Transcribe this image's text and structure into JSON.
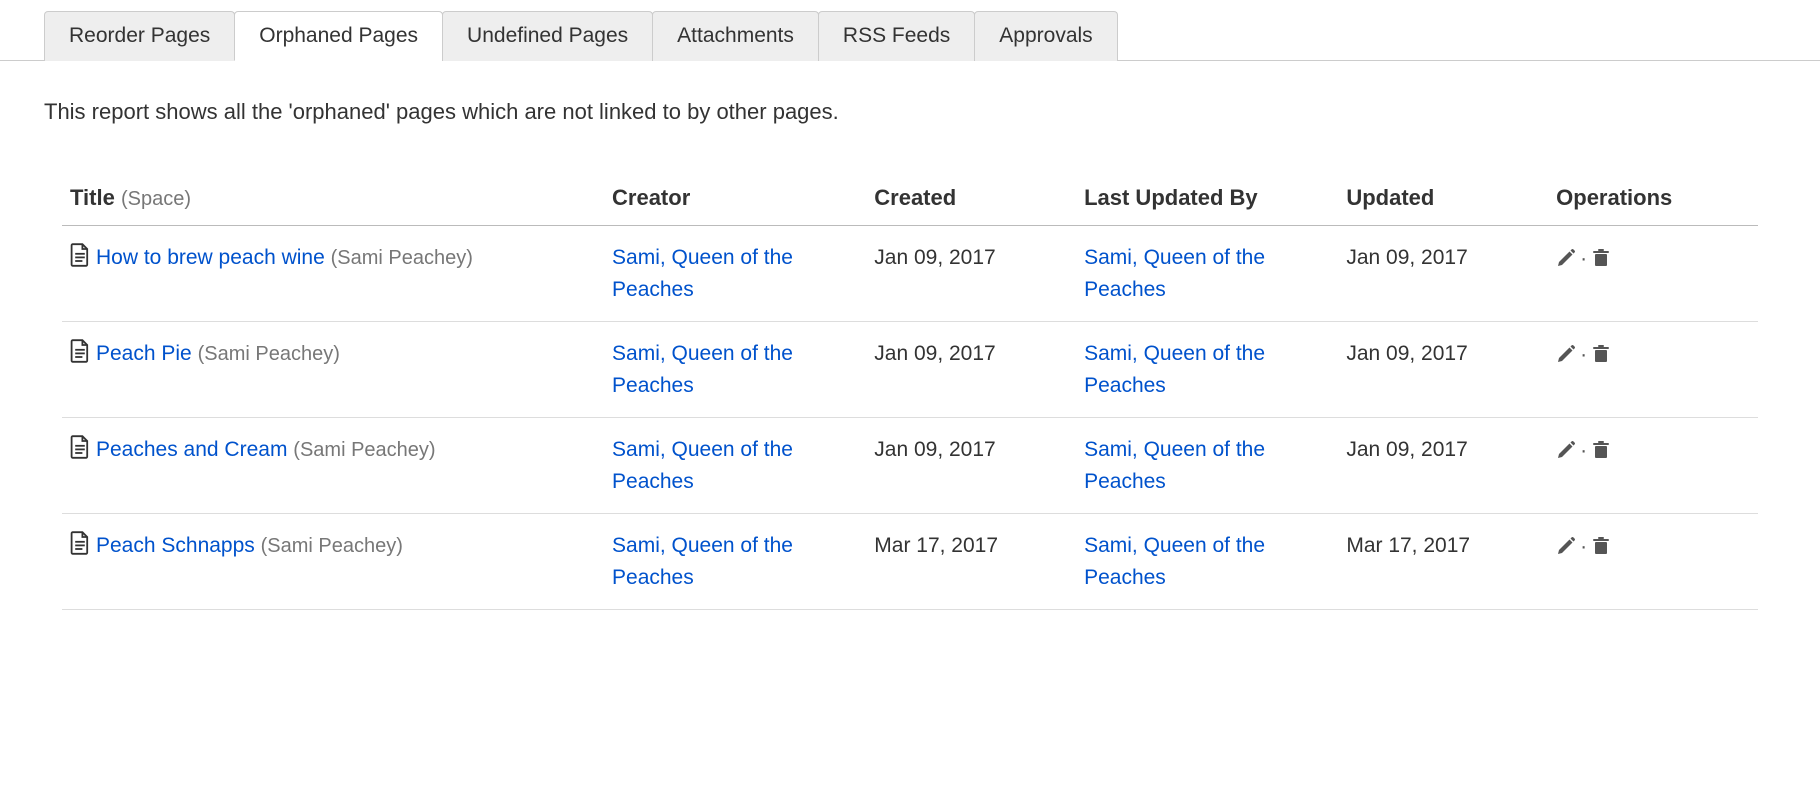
{
  "tabs": [
    {
      "label": "Reorder Pages",
      "active": false
    },
    {
      "label": "Orphaned Pages",
      "active": true
    },
    {
      "label": "Undefined Pages",
      "active": false
    },
    {
      "label": "Attachments",
      "active": false
    },
    {
      "label": "RSS Feeds",
      "active": false
    },
    {
      "label": "Approvals",
      "active": false
    }
  ],
  "description": "This report shows all the 'orphaned' pages which are not linked to by other pages.",
  "table": {
    "headers": {
      "title": "Title",
      "title_suffix": "(Space)",
      "creator": "Creator",
      "created": "Created",
      "updated_by": "Last Updated By",
      "updated": "Updated",
      "operations": "Operations"
    },
    "rows": [
      {
        "title": "How to brew peach wine",
        "space": "(Sami Peachey)",
        "creator": "Sami, Queen of the Peaches",
        "created": "Jan 09, 2017",
        "updated_by": "Sami, Queen of the Peaches",
        "updated": "Jan 09, 2017"
      },
      {
        "title": "Peach Pie",
        "space": "(Sami Peachey)",
        "creator": "Sami, Queen of the Peaches",
        "created": "Jan 09, 2017",
        "updated_by": "Sami, Queen of the Peaches",
        "updated": "Jan 09, 2017"
      },
      {
        "title": "Peaches and Cream",
        "space": "(Sami Peachey)",
        "creator": "Sami, Queen of the Peaches",
        "created": "Jan 09, 2017",
        "updated_by": "Sami, Queen of the Peaches",
        "updated": "Jan 09, 2017"
      },
      {
        "title": "Peach Schnapps",
        "space": "(Sami Peachey)",
        "creator": "Sami, Queen of the Peaches",
        "created": "Mar 17, 2017",
        "updated_by": "Sami, Queen of the Peaches",
        "updated": "Mar 17, 2017"
      }
    ]
  },
  "op_separator": "·"
}
